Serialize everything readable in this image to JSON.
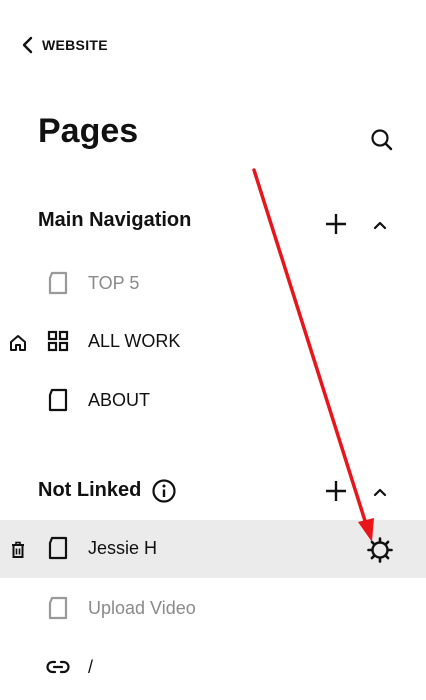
{
  "header": {
    "back_label": "WEBSITE",
    "title": "Pages"
  },
  "sections": [
    {
      "title": "Main Navigation",
      "items": [
        {
          "label": "TOP 5",
          "icon": "page-icon",
          "muted": true
        },
        {
          "label": "ALL WORK",
          "icon": "grid-icon",
          "muted": false,
          "homepage": true
        },
        {
          "label": "ABOUT",
          "icon": "page-icon",
          "muted": false
        }
      ]
    },
    {
      "title": "Not Linked",
      "items": [
        {
          "label": "Jessie H",
          "icon": "page-icon",
          "muted": false,
          "selected": true
        },
        {
          "label": "Upload Video",
          "icon": "page-icon",
          "muted": true
        },
        {
          "label": "/",
          "icon": "link-icon",
          "muted": false
        }
      ]
    }
  ],
  "colors": {
    "accent_arrow": "#e8161b",
    "selected_row_bg": "#ebebeb",
    "muted_text": "#8a8a8a",
    "text": "#111111"
  },
  "annotation": {
    "type": "arrow",
    "points_to": "gear-icon"
  }
}
